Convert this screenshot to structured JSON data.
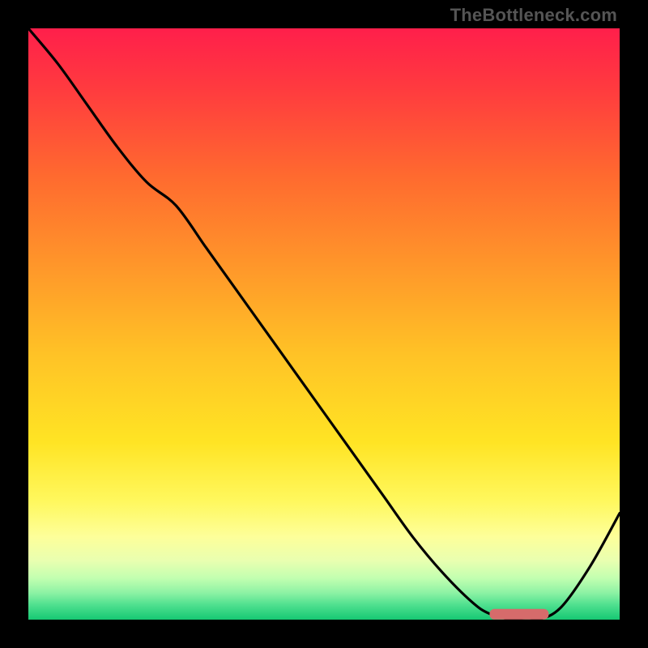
{
  "watermark": "TheBottleneck.com",
  "chart_data": {
    "type": "line",
    "title": "",
    "xlabel": "",
    "ylabel": "",
    "xlim": [
      0,
      100
    ],
    "ylim": [
      0,
      100
    ],
    "grid": false,
    "legend": false,
    "annotations": [],
    "series": [
      {
        "name": "curve",
        "x": [
          0,
          5,
          10,
          15,
          20,
          25,
          30,
          35,
          40,
          45,
          50,
          55,
          60,
          65,
          70,
          75,
          78,
          82,
          86,
          90,
          95,
          100
        ],
        "y": [
          100,
          94,
          87,
          80,
          74,
          70,
          63,
          56,
          49,
          42,
          35,
          28,
          21,
          14,
          8,
          3,
          1,
          0,
          0,
          2,
          9,
          18
        ]
      }
    ],
    "marker": {
      "name": "optimal-range",
      "x_start": 78,
      "x_end": 88,
      "y": 1,
      "color": "#d66b6b"
    },
    "background_gradient": {
      "stops": [
        {
          "offset": 0.0,
          "color": "#ff1f4b"
        },
        {
          "offset": 0.1,
          "color": "#ff3a3f"
        },
        {
          "offset": 0.25,
          "color": "#ff6a2f"
        },
        {
          "offset": 0.4,
          "color": "#ff962a"
        },
        {
          "offset": 0.55,
          "color": "#ffc226"
        },
        {
          "offset": 0.7,
          "color": "#ffe424"
        },
        {
          "offset": 0.8,
          "color": "#fff85e"
        },
        {
          "offset": 0.86,
          "color": "#fdff9a"
        },
        {
          "offset": 0.9,
          "color": "#e9ffb0"
        },
        {
          "offset": 0.93,
          "color": "#c2ffb0"
        },
        {
          "offset": 0.955,
          "color": "#8cf2a4"
        },
        {
          "offset": 0.975,
          "color": "#4fe08f"
        },
        {
          "offset": 1.0,
          "color": "#16c873"
        }
      ]
    }
  }
}
